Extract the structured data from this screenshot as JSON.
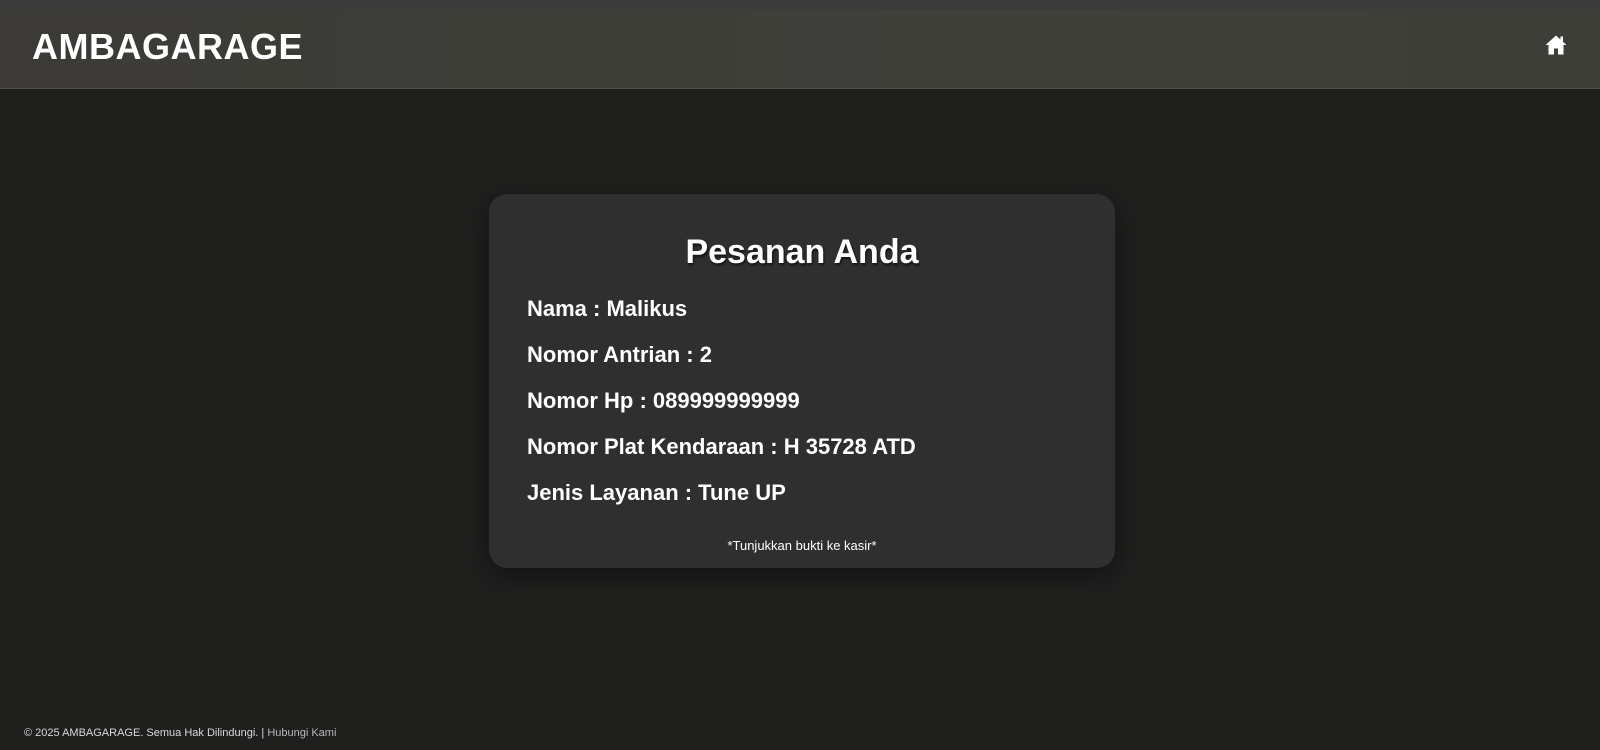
{
  "header": {
    "brand": "AMBAGARAGE",
    "home_icon": "home-icon"
  },
  "order_card": {
    "title": "Pesanan Anda",
    "rows": [
      "Nama : Malikus",
      "Nomor Antrian : 2",
      "Nomor Hp : 089999999999",
      "Nomor Plat Kendaraan : H 35728 ATD",
      "Jenis Layanan : Tune UP"
    ],
    "note": "*Tunjukkan bukti ke kasir*"
  },
  "footer": {
    "copyright": "© 2025 AMBAGARAGE. Semua Hak Dilindungi.",
    "separator": " | ",
    "contact_link": "Hubungi Kami"
  },
  "colors": {
    "background": "#1f201e",
    "navbar": "#3e3f39",
    "card": "#2f2f2f",
    "text": "#ffffff"
  }
}
